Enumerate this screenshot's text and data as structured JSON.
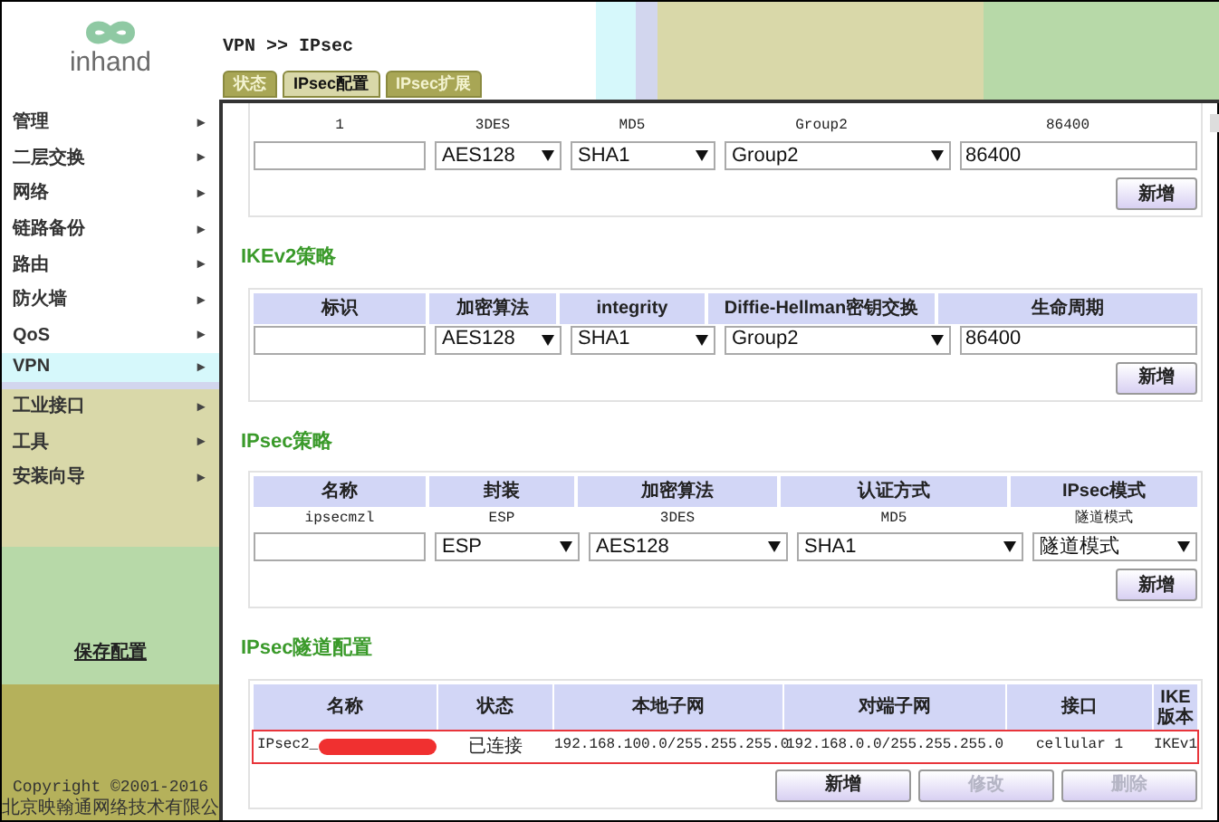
{
  "logo": {
    "text": "inhand"
  },
  "breadcrumb": "VPN >> IPsec",
  "tabs": [
    {
      "label": "状态",
      "selected": false
    },
    {
      "label": "IPsec配置",
      "selected": true
    },
    {
      "label": "IPsec扩展",
      "selected": false
    }
  ],
  "sidebar": {
    "items": [
      {
        "label": "管理",
        "selected": false
      },
      {
        "label": "二层交换",
        "selected": false
      },
      {
        "label": "网络",
        "selected": false
      },
      {
        "label": "链路备份",
        "selected": false
      },
      {
        "label": "路由",
        "selected": false
      },
      {
        "label": "防火墙",
        "selected": false
      },
      {
        "label": "QoS",
        "selected": false
      },
      {
        "label": "VPN",
        "selected": true
      },
      {
        "label": "工业接口",
        "selected": false
      },
      {
        "label": "工具",
        "selected": false
      },
      {
        "label": "安装向导",
        "selected": false
      }
    ],
    "arrow": "▸",
    "save_link": "保存配置",
    "copyright": "Copyright ©2001-2016",
    "company": "北京映翰通网络技术有限公"
  },
  "ikev1_policy": {
    "row": [
      "1",
      "3DES",
      "MD5",
      "Group2",
      "86400"
    ],
    "inputs": [
      {
        "kind": "text"
      },
      {
        "kind": "select",
        "value": "AES128"
      },
      {
        "kind": "select",
        "value": "SHA1"
      },
      {
        "kind": "select",
        "value": "Group2"
      },
      {
        "kind": "text",
        "value": "86400"
      }
    ],
    "button": "新增"
  },
  "ikev2_policy": {
    "title": "IKEv2策略",
    "columns": [
      "标识",
      "加密算法",
      "integrity",
      "Diffie-Hellman密钥交换",
      "生命周期"
    ],
    "inputs": [
      {
        "kind": "text"
      },
      {
        "kind": "select",
        "value": "AES128"
      },
      {
        "kind": "select",
        "value": "SHA1"
      },
      {
        "kind": "select",
        "value": "Group2"
      },
      {
        "kind": "text",
        "value": "86400"
      }
    ],
    "button": "新增"
  },
  "ipsec_policy": {
    "title": "IPsec策略",
    "columns": [
      "名称",
      "封装",
      "加密算法",
      "认证方式",
      "IPsec模式"
    ],
    "row": [
      "ipsecmzl",
      "ESP",
      "3DES",
      "MD5",
      "隧道模式"
    ],
    "inputs": [
      {
        "kind": "text"
      },
      {
        "kind": "select",
        "value": "ESP"
      },
      {
        "kind": "select",
        "value": "AES128"
      },
      {
        "kind": "select",
        "value": "SHA1"
      },
      {
        "kind": "select",
        "value": "隧道模式"
      }
    ],
    "button": "新增"
  },
  "tunnel_config": {
    "title": "IPsec隧道配置",
    "columns": [
      "名称",
      "状态",
      "本地子网",
      "对端子网",
      "接口",
      "IKE版本"
    ],
    "rows": [
      {
        "highlighted": true,
        "redacted": true,
        "cells": [
          "IPsec2_",
          "已连接",
          "192.168.100.0/255.255.255.0",
          "192.168.0.0/255.255.255.0",
          "cellular 1",
          "IKEv1"
        ]
      }
    ],
    "buttons": [
      {
        "label": "新增",
        "disabled": false
      },
      {
        "label": "修改",
        "disabled": true
      },
      {
        "label": "删除",
        "disabled": true
      }
    ]
  }
}
